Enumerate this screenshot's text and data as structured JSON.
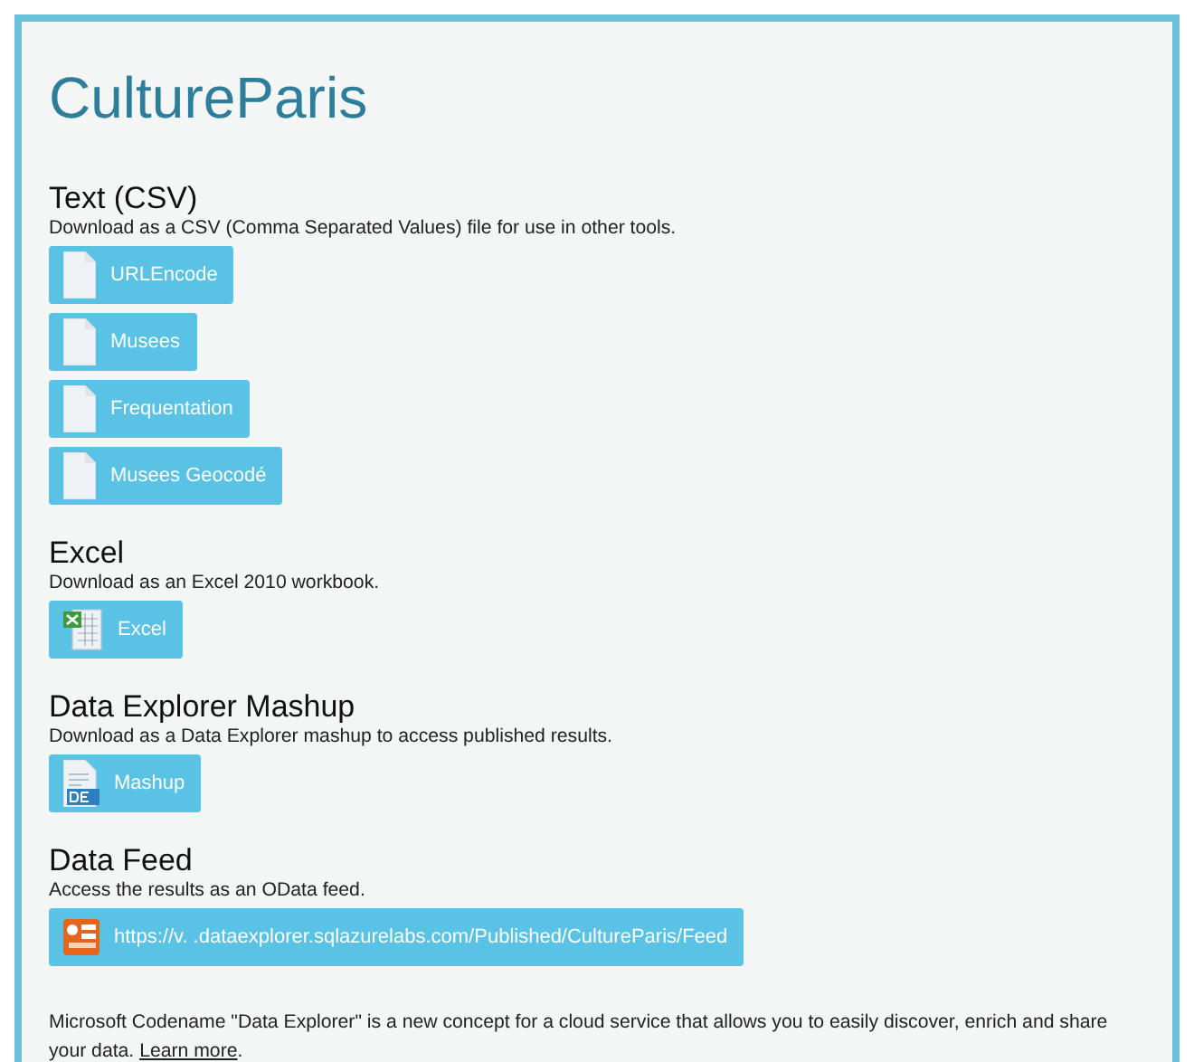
{
  "title": "CultureParis",
  "sections": [
    {
      "heading": "Text (CSV)",
      "description": "Download as a CSV (Comma Separated Values) file for use in other tools.",
      "buttons": [
        {
          "label": "URLEncode",
          "kind": "document"
        },
        {
          "label": "Musees",
          "kind": "document"
        },
        {
          "label": "Frequentation",
          "kind": "document"
        },
        {
          "label": "Musees Geocodé",
          "kind": "document"
        }
      ]
    },
    {
      "heading": "Excel",
      "description": "Download as an Excel 2010 workbook.",
      "buttons": [
        {
          "label": "Excel",
          "kind": "excel"
        }
      ]
    },
    {
      "heading": "Data Explorer Mashup",
      "description": "Download as a Data Explorer mashup to access published results.",
      "buttons": [
        {
          "label": "Mashup",
          "kind": "mashup"
        }
      ]
    },
    {
      "heading": "Data Feed",
      "description": "Access the results as an OData feed.",
      "buttons": [
        {
          "label": "https://v. .dataexplorer.sqlazurelabs.com/Published/CultureParis/Feed",
          "kind": "feed"
        }
      ]
    }
  ],
  "footer": {
    "text": "Microsoft Codename \"Data Explorer\" is a new concept for a cloud service that allows you to easily discover, enrich and share your data. ",
    "link": "Learn more",
    "end": "."
  }
}
